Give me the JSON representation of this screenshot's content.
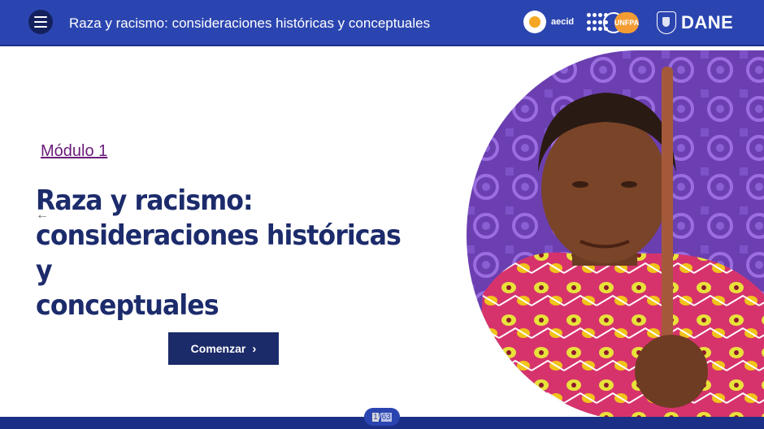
{
  "header": {
    "title": "Raza y racismo: consideraciones históricas y conceptuales",
    "menu_icon": "hamburger-menu-icon",
    "logos": {
      "aecid": "aecid",
      "unfpa": "UNFPA",
      "dane": "DANE"
    }
  },
  "content": {
    "module_label": "Módulo 1",
    "title_lines": [
      "Raza y racismo:",
      "consideraciones históricas y",
      "conceptuales"
    ],
    "start_button": "Comenzar",
    "prev_icon": "arrow-left-icon"
  },
  "pagination": {
    "current": "1",
    "separator": "/",
    "total": "63"
  },
  "colors": {
    "header_bg": "#2b45b0",
    "title_color": "#1c2b6b",
    "module_color": "#6a1b7a",
    "button_bg": "#1b2a68",
    "footer_bg": "#1c2f86"
  }
}
